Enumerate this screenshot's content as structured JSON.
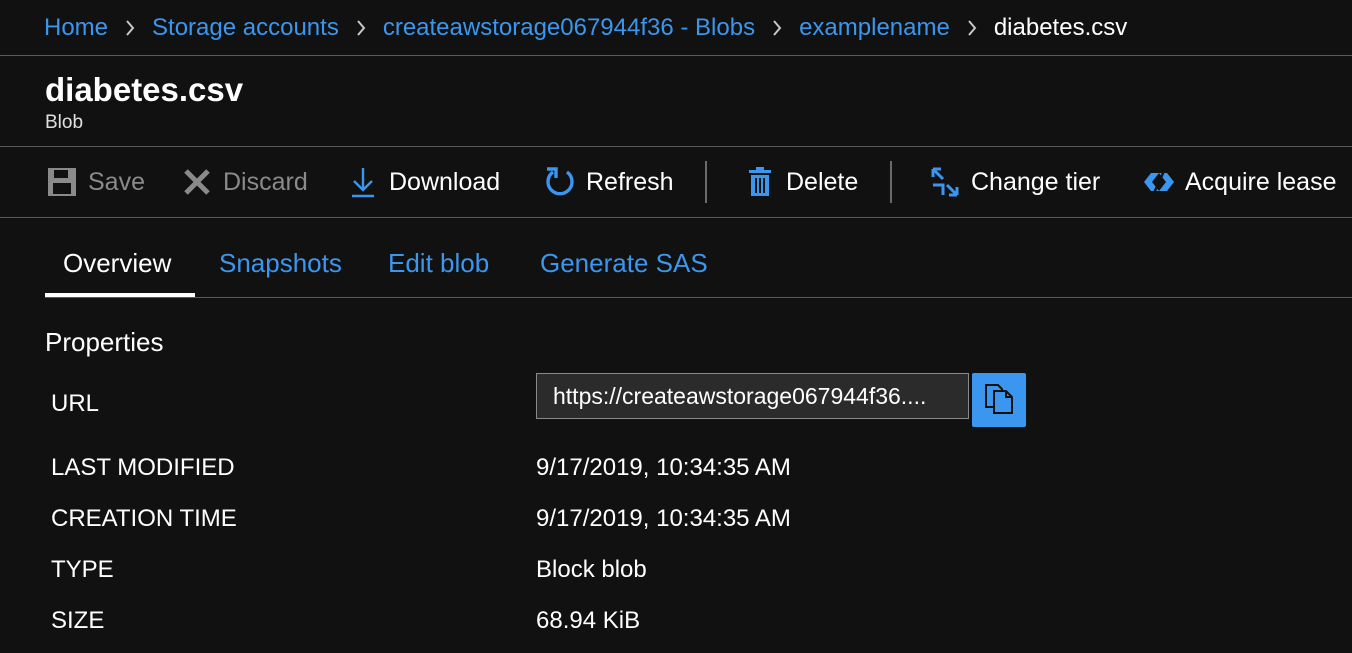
{
  "breadcrumb": {
    "items": [
      {
        "label": "Home"
      },
      {
        "label": "Storage accounts"
      },
      {
        "label": "createawstorage067944f36 - Blobs"
      },
      {
        "label": "examplename"
      }
    ],
    "current": "diabetes.csv"
  },
  "header": {
    "title": "diabetes.csv",
    "subtitle": "Blob"
  },
  "toolbar": {
    "save_label": "Save",
    "discard_label": "Discard",
    "download_label": "Download",
    "refresh_label": "Refresh",
    "delete_label": "Delete",
    "change_tier_label": "Change tier",
    "acquire_lease_label": "Acquire lease",
    "icons": {
      "save": "save-icon",
      "discard": "discard-icon",
      "download": "download-icon",
      "refresh": "refresh-icon",
      "delete": "delete-icon",
      "change_tier": "change-tier-icon",
      "acquire_lease": "acquire-lease-icon"
    }
  },
  "tabs": [
    {
      "label": "Overview",
      "active": true
    },
    {
      "label": "Snapshots",
      "active": false
    },
    {
      "label": "Edit blob",
      "active": false
    },
    {
      "label": "Generate SAS",
      "active": false
    }
  ],
  "properties": {
    "section_title": "Properties",
    "url_label": "URL",
    "url_value": "https://createawstorage067944f36....",
    "last_modified_label": "LAST MODIFIED",
    "last_modified_value": "9/17/2019, 10:34:35 AM",
    "creation_time_label": "CREATION TIME",
    "creation_time_value": "9/17/2019, 10:34:35 AM",
    "type_label": "TYPE",
    "type_value": "Block blob",
    "size_label": "SIZE",
    "size_value": "68.94 KiB"
  },
  "colors": {
    "background": "#111111",
    "link": "#3a96ee",
    "accent": "#3a96ee",
    "disabled": "#8a8a8a",
    "divider": "#5a5a5a"
  }
}
